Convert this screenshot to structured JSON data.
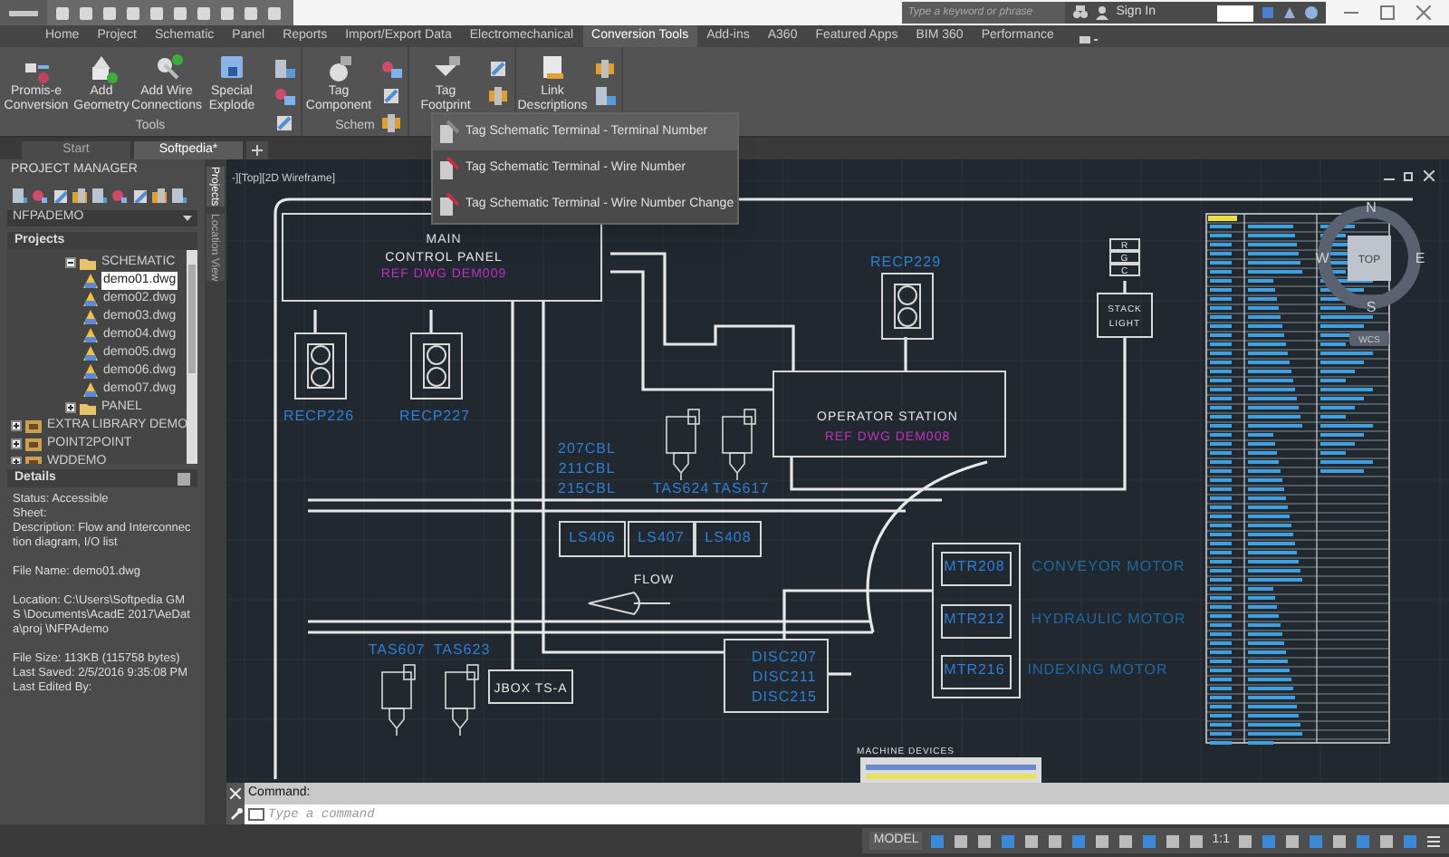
{
  "title_bar": {
    "search": {
      "placeholder": "Type a keyword or phrase"
    },
    "sign_in": "Sign In"
  },
  "ribbon_tabs": [
    {
      "label": "Home",
      "selected": false
    },
    {
      "label": "Project",
      "selected": false
    },
    {
      "label": "Schematic",
      "selected": false
    },
    {
      "label": "Panel",
      "selected": false
    },
    {
      "label": "Reports",
      "selected": false
    },
    {
      "label": "Import/Export Data",
      "selected": false
    },
    {
      "label": "Electromechanical",
      "selected": false
    },
    {
      "label": "Conversion Tools",
      "selected": true
    },
    {
      "label": "Add-ins",
      "selected": false
    },
    {
      "label": "A360",
      "selected": false
    },
    {
      "label": "Featured Apps",
      "selected": false
    },
    {
      "label": "BIM 360",
      "selected": false
    },
    {
      "label": "Performance",
      "selected": false
    }
  ],
  "ribbon_panels": [
    {
      "title": "Tools",
      "buttons": [
        "Promis-e Conversion",
        "Add Geometry",
        "Add Wire Connections",
        "Special Explode"
      ]
    },
    {
      "title": "Schem",
      "buttons": [
        "Tag Component"
      ]
    },
    {
      "buttons": [
        "Tag Footprint"
      ]
    },
    {
      "buttons": [
        "Link Descriptions"
      ]
    }
  ],
  "dropdown_menu": [
    {
      "label": "Tag Schematic Terminal - Terminal Number",
      "selected": true
    },
    {
      "label": "Tag Schematic Terminal - Wire Number",
      "selected": false
    },
    {
      "label": "Tag Schematic Terminal - Wire Number Change",
      "selected": false
    }
  ],
  "document_tabs": [
    {
      "label": "Start",
      "selected": false
    },
    {
      "label": "Softpedia*",
      "selected": true
    }
  ],
  "project_manager": {
    "title": "PROJECT MANAGER",
    "project": "NFPADEMO",
    "section": "Projects",
    "tree": [
      {
        "label": "SCHEMATIC",
        "kind": "folder",
        "expanded": true,
        "children": [
          {
            "label": "demo01.dwg",
            "kind": "drawing",
            "selected": true
          },
          {
            "label": "demo02.dwg",
            "kind": "drawing",
            "selected": false
          },
          {
            "label": "demo03.dwg",
            "kind": "drawing",
            "selected": false
          },
          {
            "label": "demo04.dwg",
            "kind": "drawing",
            "selected": false
          },
          {
            "label": "demo05.dwg",
            "kind": "drawing",
            "selected": false
          },
          {
            "label": "demo06.dwg",
            "kind": "drawing",
            "selected": false
          },
          {
            "label": "demo07.dwg",
            "kind": "drawing",
            "selected": false
          }
        ]
      },
      {
        "label": "PANEL",
        "kind": "folder",
        "expanded": false
      },
      {
        "label": "EXTRA LIBRARY DEMO",
        "kind": "project",
        "expanded": false
      },
      {
        "label": "POINT2POINT",
        "kind": "project",
        "expanded": false
      },
      {
        "label": "WDDEMO",
        "kind": "project",
        "expanded": false
      }
    ],
    "side_tabs": [
      {
        "label": "Projects",
        "selected": true
      },
      {
        "label": "Location View",
        "selected": false
      }
    ]
  },
  "details": {
    "title": "Details",
    "paragraphs": [
      [
        "Status: Accessible",
        "Sheet:",
        "Description: Flow and Interconnection diagram, I/O list"
      ],
      [
        "File Name: demo01.dwg"
      ],
      [
        "Location: C:\\Users\\Softpedia GMS \\Documents\\AcadE 2017\\AeData\\proj \\NFPAdemo"
      ],
      [
        "File Size: 113KB (115758 bytes)",
        "Last Saved: 2/5/2016 9:35:08 PM",
        "Last Edited By:"
      ]
    ]
  },
  "viewport": {
    "label": "-][Top][2D Wireframe]",
    "viewcube": {
      "top": "TOP",
      "north": "N",
      "south": "S",
      "east": "E",
      "west": "W",
      "ucs": "WCS"
    }
  },
  "drawing": {
    "labels": [
      {
        "text": "MAIN",
        "kind": "note"
      },
      {
        "text": "CONTROL PANEL",
        "kind": "note"
      },
      {
        "text": "REF DWG DEM009",
        "kind": "ref"
      },
      {
        "text": "RECP226",
        "kind": "tag"
      },
      {
        "text": "RECP227",
        "kind": "tag"
      },
      {
        "text": "RECP229",
        "kind": "tag"
      },
      {
        "text": "OPERATOR STATION",
        "kind": "note"
      },
      {
        "text": "REF DWG DEM008",
        "kind": "ref"
      },
      {
        "text": "R",
        "kind": "small"
      },
      {
        "text": "G",
        "kind": "small"
      },
      {
        "text": "C",
        "kind": "small"
      },
      {
        "text": "STACK",
        "kind": "small"
      },
      {
        "text": "LIGHT",
        "kind": "small"
      },
      {
        "text": "207CBL",
        "kind": "tag"
      },
      {
        "text": "211CBL",
        "kind": "tag"
      },
      {
        "text": "215CBL",
        "kind": "tag"
      },
      {
        "text": "TAS624",
        "kind": "tag"
      },
      {
        "text": "TAS617",
        "kind": "tag"
      },
      {
        "text": "LS406",
        "kind": "tag"
      },
      {
        "text": "LS407",
        "kind": "tag"
      },
      {
        "text": "LS408",
        "kind": "tag"
      },
      {
        "text": "FLOW",
        "kind": "note"
      },
      {
        "text": "TAS607",
        "kind": "tag"
      },
      {
        "text": "TAS623",
        "kind": "tag"
      },
      {
        "text": "JBOX TS-A",
        "kind": "note"
      },
      {
        "text": "DISC207",
        "kind": "tag"
      },
      {
        "text": "DISC211",
        "kind": "tag"
      },
      {
        "text": "DISC215",
        "kind": "tag"
      },
      {
        "text": "MTR208",
        "kind": "tag"
      },
      {
        "text": "MTR212",
        "kind": "tag"
      },
      {
        "text": "MTR216",
        "kind": "tag"
      },
      {
        "text": "CONVEYOR MOTOR",
        "kind": "description"
      },
      {
        "text": "HYDRAULIC MOTOR",
        "kind": "description"
      },
      {
        "text": "INDEXING MOTOR",
        "kind": "description"
      },
      {
        "text": "MACHINE DEVICES",
        "kind": "small"
      }
    ]
  },
  "command_line": {
    "history": "Command:",
    "placeholder": "Type a command"
  },
  "status_bar": {
    "model": "MODEL",
    "scale": "1:1"
  }
}
